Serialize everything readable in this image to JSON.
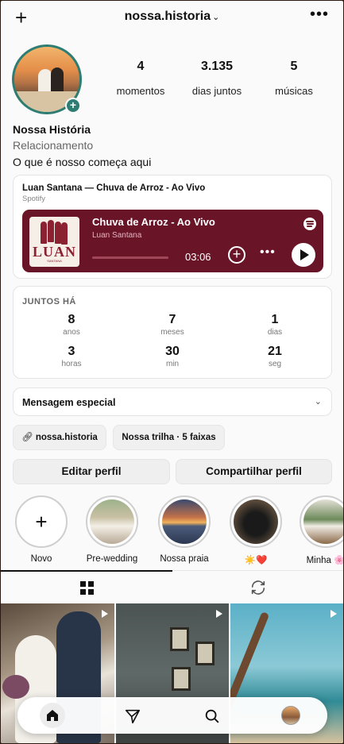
{
  "header": {
    "username": "nossa.historia"
  },
  "stats": [
    {
      "value": "4",
      "label": "momentos"
    },
    {
      "value": "3.135",
      "label": "dias juntos"
    },
    {
      "value": "5",
      "label": "músicas"
    }
  ],
  "bio": {
    "name": "Nossa História",
    "category": "Relacionamento",
    "text": "O que é nosso começa aqui"
  },
  "music": {
    "card_title": "Luan Santana — Chuva de Arroz - Ao Vivo",
    "source": "Spotify",
    "song": "Chuva de Arroz - Ao Vivo",
    "artist": "Luan Santana",
    "duration": "03:06",
    "cover_text": "LUAN",
    "cover_sub": "SANTANA",
    "progress": 0
  },
  "together": {
    "heading": "JUNTOS HÁ",
    "cells": [
      {
        "value": "8",
        "unit": "anos"
      },
      {
        "value": "7",
        "unit": "meses"
      },
      {
        "value": "1",
        "unit": "dias"
      },
      {
        "value": "3",
        "unit": "horas"
      },
      {
        "value": "30",
        "unit": "min"
      },
      {
        "value": "21",
        "unit": "seg"
      }
    ]
  },
  "special_message": {
    "label": "Mensagem especial"
  },
  "links": {
    "profile_link": "nossa.historia",
    "playlist": "Nossa trilha · 5 faixas"
  },
  "actions": {
    "edit": "Editar perfil",
    "share": "Compartilhar perfil"
  },
  "highlights": [
    {
      "label": "Novo"
    },
    {
      "label": "Pre-wedding"
    },
    {
      "label": "Nossa praia"
    },
    {
      "label": "☀️❤️"
    },
    {
      "label": "Minha 🌸"
    }
  ],
  "colors": {
    "accent": "#2e7d72",
    "player_bg": "#6a1428",
    "background": "#fafafa"
  }
}
